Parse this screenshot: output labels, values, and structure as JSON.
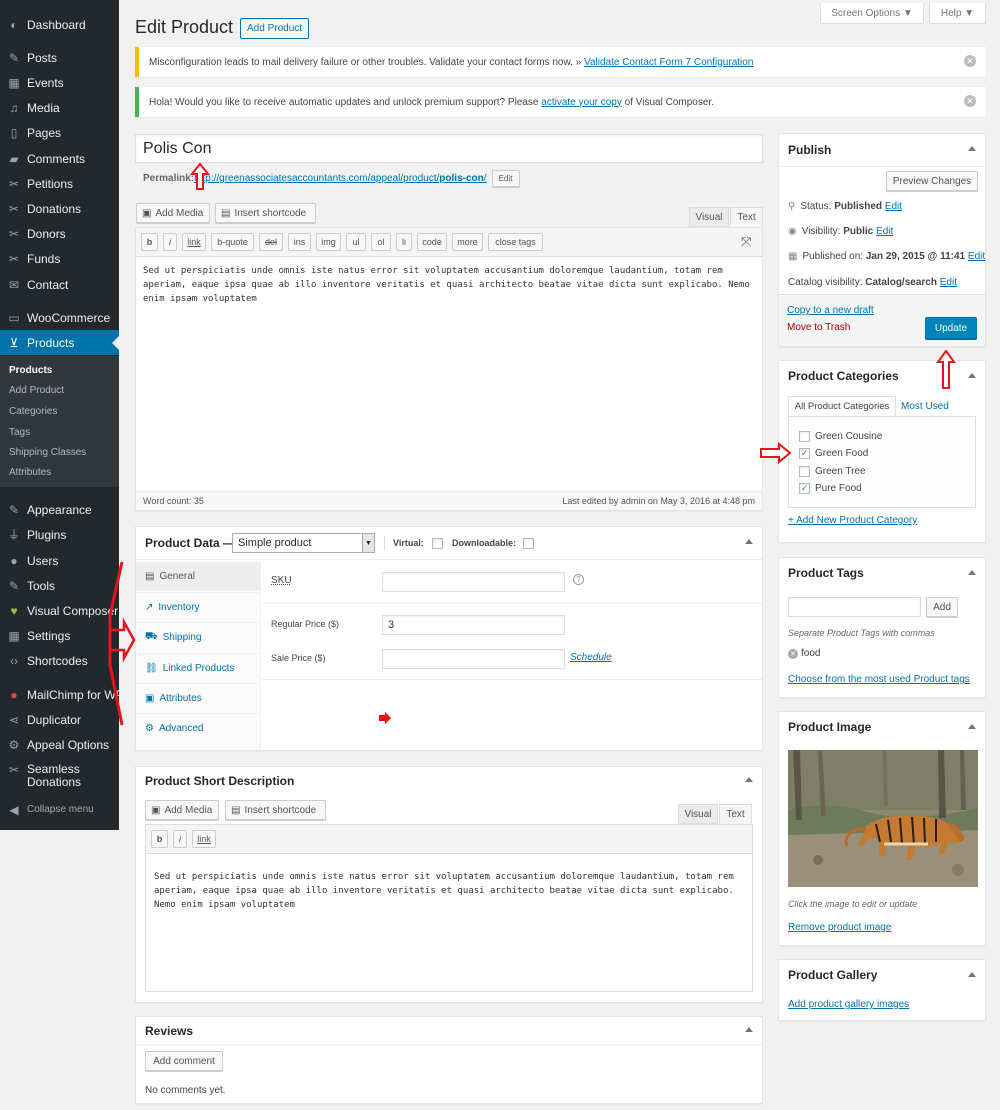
{
  "sidebar": {
    "items": [
      {
        "label": "Dashboard",
        "icon": "dashboard-icon"
      },
      {
        "label": "Posts",
        "icon": "pin-icon"
      },
      {
        "label": "Events",
        "icon": "calendar-icon"
      },
      {
        "label": "Media",
        "icon": "media-icon"
      },
      {
        "label": "Pages",
        "icon": "page-icon"
      },
      {
        "label": "Comments",
        "icon": "comment-icon"
      },
      {
        "label": "Petitions",
        "icon": "tool-icon"
      },
      {
        "label": "Donations",
        "icon": "tool-icon"
      },
      {
        "label": "Donors",
        "icon": "tool-icon"
      },
      {
        "label": "Funds",
        "icon": "tool-icon"
      },
      {
        "label": "Contact",
        "icon": "mail-icon"
      },
      {
        "label": "WooCommerce",
        "icon": "woo-icon"
      },
      {
        "label": "Products",
        "icon": "cart-icon"
      },
      {
        "label": "Appearance",
        "icon": "brush-icon"
      },
      {
        "label": "Plugins",
        "icon": "plug-icon"
      },
      {
        "label": "Users",
        "icon": "user-icon"
      },
      {
        "label": "Tools",
        "icon": "wrench-icon"
      },
      {
        "label": "Visual Composer",
        "icon": "vc-icon"
      },
      {
        "label": "Settings",
        "icon": "settings-icon"
      },
      {
        "label": "Shortcodes",
        "icon": "code-icon"
      },
      {
        "label": "MailChimp for WP",
        "icon": "mailchimp-icon"
      },
      {
        "label": "Duplicator",
        "icon": "share-icon"
      },
      {
        "label": "Appeal Options",
        "icon": "gear-icon"
      },
      {
        "label": "Seamless",
        "label2": "Donations",
        "icon": "tool-icon"
      },
      {
        "label": "Collapse menu",
        "icon": "collapse-icon"
      }
    ],
    "submenu": [
      "Products",
      "Add Product",
      "Categories",
      "Tags",
      "Shipping Classes",
      "Attributes"
    ]
  },
  "screen_options": "Screen Options ▼",
  "help": "Help ▼",
  "page_title": "Edit Product",
  "add_product_button": "Add Product",
  "notice1": {
    "text": "Misconfiguration leads to mail delivery failure or other troubles. Validate your contact forms now. » ",
    "link": "Validate Contact Form 7 Configuration"
  },
  "notice2": {
    "text": "Hola! Would you like to receive automatic updates and unlock premium support? Please ",
    "link": "activate your copy",
    "text2": " of Visual Composer."
  },
  "title_input": "Polis Con",
  "permalink": {
    "label": "Permalink: ",
    "url": "http://greenassociatesaccountants.com/appeal/product/",
    "slug": "polis-con",
    "end": "/",
    "edit": "Edit"
  },
  "editor": {
    "add_media": "Add Media",
    "insert_shortcode": "Insert shortcode",
    "tab_visual": "Visual",
    "tab_text": "Text",
    "quicktags": [
      "b",
      "i",
      "link",
      "b-quote",
      "del",
      "ins",
      "img",
      "ul",
      "ol",
      "li",
      "code",
      "more",
      "close tags"
    ],
    "content": "Sed ut perspiciatis unde omnis iste natus error sit voluptatem accusantium doloremque laudantium, totam rem aperiam, eaque ipsa quae ab illo inventore veritatis et quasi architecto beatae vitae dicta sunt explicabo. Nemo enim ipsam voluptatem",
    "word_count": "Word count: 35",
    "last_edited": "Last edited by admin on May 3, 2016 at 4:48 pm"
  },
  "product_data": {
    "title": "Product Data —",
    "type": "Simple product",
    "virtual": "Virtual:",
    "downloadable": "Downloadable:",
    "tabs": [
      "General",
      "Inventory",
      "Shipping",
      "Linked Products",
      "Attributes",
      "Advanced"
    ],
    "sku_label": "SKU",
    "sku_value": "",
    "regular_price_label": "Regular Price ($)",
    "regular_price_value": "3",
    "sale_price_label": "Sale Price ($)",
    "sale_price_value": "",
    "schedule": "Schedule"
  },
  "short_description": {
    "title": "Product Short Description",
    "add_media": "Add Media",
    "insert_shortcode": "Insert shortcode",
    "tab_visual": "Visual",
    "tab_text": "Text",
    "quicktags": [
      "b",
      "i",
      "link"
    ],
    "content": "Sed ut perspiciatis unde omnis iste natus error sit voluptatem accusantium doloremque laudantium, totam rem aperiam, eaque ipsa quae ab illo inventore veritatis et quasi architecto beatae vitae dicta sunt explicabo. Nemo enim ipsam voluptatem"
  },
  "reviews": {
    "title": "Reviews",
    "add_comment": "Add comment",
    "none": "No comments yet."
  },
  "publish": {
    "title": "Publish",
    "preview": "Preview Changes",
    "status_label": "Status: ",
    "status": "Published",
    "edit": "Edit",
    "visibility_label": "Visibility: ",
    "visibility": "Public",
    "published_label": "Published on: ",
    "published": "Jan 29, 2015 @ 11:41",
    "catalog_label": "Catalog visibility: ",
    "catalog": "Catalog/search",
    "copy_draft": "Copy to a new draft",
    "trash": "Move to Trash",
    "update": "Update"
  },
  "categories": {
    "title": "Product Categories",
    "tab_all": "All Product Categories",
    "tab_most": "Most Used",
    "items": [
      {
        "label": "Green Cousine",
        "checked": false
      },
      {
        "label": "Green Food",
        "checked": true
      },
      {
        "label": "Green Tree",
        "checked": false
      },
      {
        "label": "Pure Food",
        "checked": true
      }
    ],
    "add_new": "+ Add New Product Category"
  },
  "tags": {
    "title": "Product Tags",
    "add": "Add",
    "hint": "Separate Product Tags with commas",
    "tag": "food",
    "choose": "Choose from the most used Product tags"
  },
  "product_image": {
    "title": "Product Image",
    "hint": "Click the image to edit or update",
    "remove": "Remove product image"
  },
  "gallery": {
    "title": "Product Gallery",
    "add": "Add product gallery images"
  },
  "colors": {
    "admin_bar": "#23282d",
    "accent": "#0073aa",
    "annotation": "#e8121b"
  }
}
